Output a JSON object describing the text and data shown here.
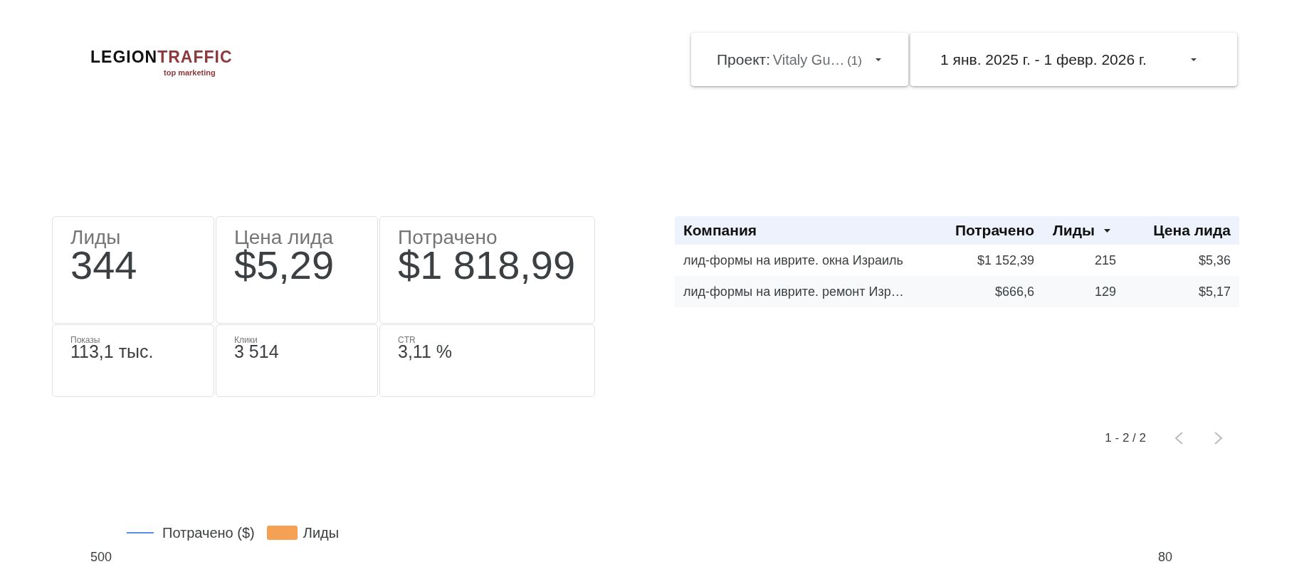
{
  "logo": {
    "name_dark": "LEGION",
    "name_accent": "TRAFFIC",
    "tagline": "top marketing"
  },
  "filters": [
    {
      "kind": "project",
      "label": "Проект:",
      "value": "Vitaly Gu…",
      "count": "(1)"
    },
    {
      "kind": "date_range",
      "value": "1 янв. 2025 г. - 1 февр. 2026 г."
    }
  ],
  "scorecards": [
    {
      "kind": "primary",
      "title": "Лиды",
      "value": "344"
    },
    {
      "kind": "primary",
      "title": "Цена лида",
      "value": "$5,29"
    },
    {
      "kind": "primary",
      "title": "Потрачено",
      "value": "$1 818,99"
    },
    {
      "kind": "secondary",
      "title": "Показы",
      "value": "113,1 тыс."
    },
    {
      "kind": "secondary",
      "title": "Клики",
      "value": "3 514"
    },
    {
      "kind": "secondary",
      "title": "CTR",
      "value": "3,11 %"
    }
  ],
  "table": {
    "columns": [
      {
        "label": "Компания",
        "kind": "text",
        "sorted": false
      },
      {
        "label": "Потрачено",
        "kind": "number",
        "sorted": false
      },
      {
        "label": "Лиды",
        "kind": "number",
        "sorted": true
      },
      {
        "label": "Цена лида",
        "kind": "number",
        "sorted": false
      }
    ],
    "rows": [
      [
        "лид-формы на иврите. окна Израиль",
        "$1 152,39",
        "215",
        "$5,36"
      ],
      [
        "лид-формы на иврите. ремонт Изр…",
        "$666,6",
        "129",
        "$5,17"
      ]
    ]
  },
  "pagination": {
    "range": "1 - 2 / 2",
    "previous": {
      "disabled": true
    },
    "next": {
      "disabled": true
    }
  },
  "chart": {
    "legend": [
      {
        "kind": "line",
        "label": "Потрачено ($)",
        "color": "#5b8fe6"
      },
      {
        "kind": "bar",
        "label": "Лиды",
        "color": "#f4a153"
      }
    ],
    "left_axis_tick": "500",
    "right_axis_tick": "80"
  }
}
